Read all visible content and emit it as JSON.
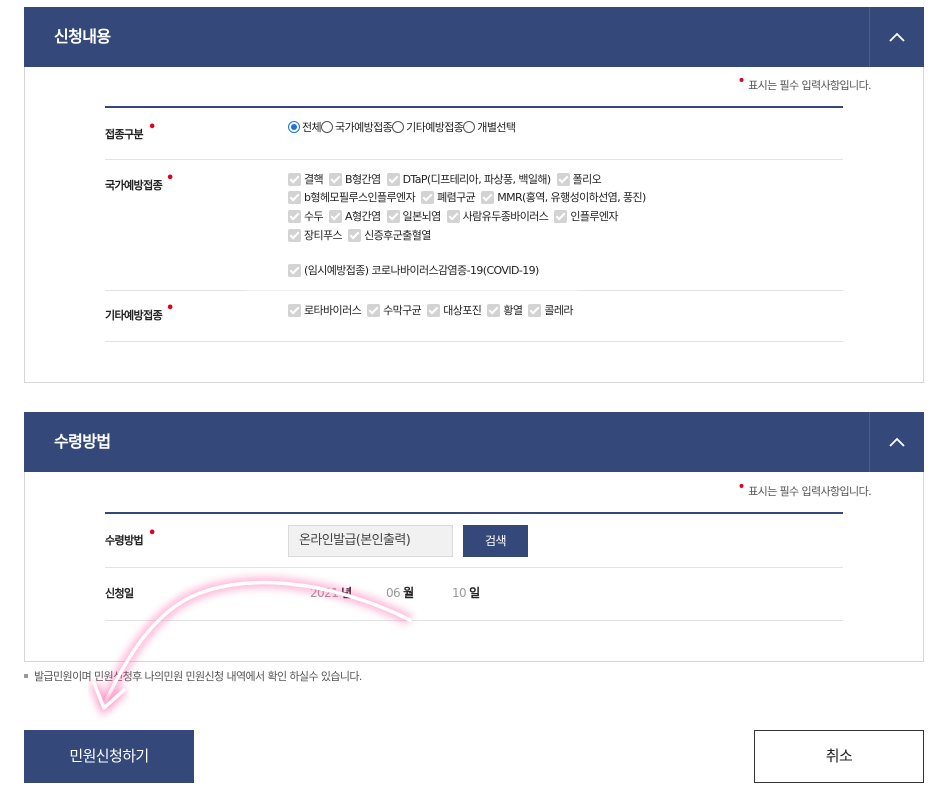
{
  "section1": {
    "title": "신청내용",
    "required_note": "표시는 필수 입력사항입니다.",
    "vaccination_type": {
      "label": "접종구분",
      "options": [
        "전체",
        "국가예방접종",
        "기타예방접종",
        "개별선택"
      ],
      "selected": "전체"
    },
    "national": {
      "label": "국가예방접종",
      "lines": [
        [
          "결핵",
          "B형간염",
          "DTaP(디프테리아, 파상풍, 백일해)",
          "폴리오"
        ],
        [
          "b형헤모필루스인플루엔자",
          "폐렴구균",
          "MMR(홍역, 유행성이하선염, 풍진)"
        ],
        [
          "수두",
          "A형간염",
          "일본뇌염",
          "사람유두종바이러스",
          "인플루엔자"
        ],
        [
          "장티푸스",
          "신증후군출혈열"
        ],
        [
          "(임시예방접종) 코로나바이러스감염증-19(COVID-19)"
        ]
      ]
    },
    "other": {
      "label": "기타예방접종",
      "items": [
        "로타바이러스",
        "수막구균",
        "대상포진",
        "황열",
        "콜레라"
      ]
    }
  },
  "section2": {
    "title": "수령방법",
    "required_note": "표시는 필수 입력사항입니다.",
    "method_label": "수령방법",
    "method_value": "온라인발급(본인출력)",
    "search_label": "검색",
    "date_label": "신청일",
    "year": "2021",
    "year_unit": "년",
    "month": "06",
    "month_unit": "월",
    "day": "10",
    "day_unit": "일"
  },
  "notice": "발급민원이며 민원신청후 나의민원 민원신청 내역에서 확인 하실수 있습니다.",
  "buttons": {
    "submit": "민원신청하기",
    "cancel": "취소"
  },
  "colors": {
    "header": "#34497a",
    "required": "#e1001b",
    "highlight": "#ff4fa3"
  },
  "icons": {
    "toggle": "chevron-up-icon"
  }
}
